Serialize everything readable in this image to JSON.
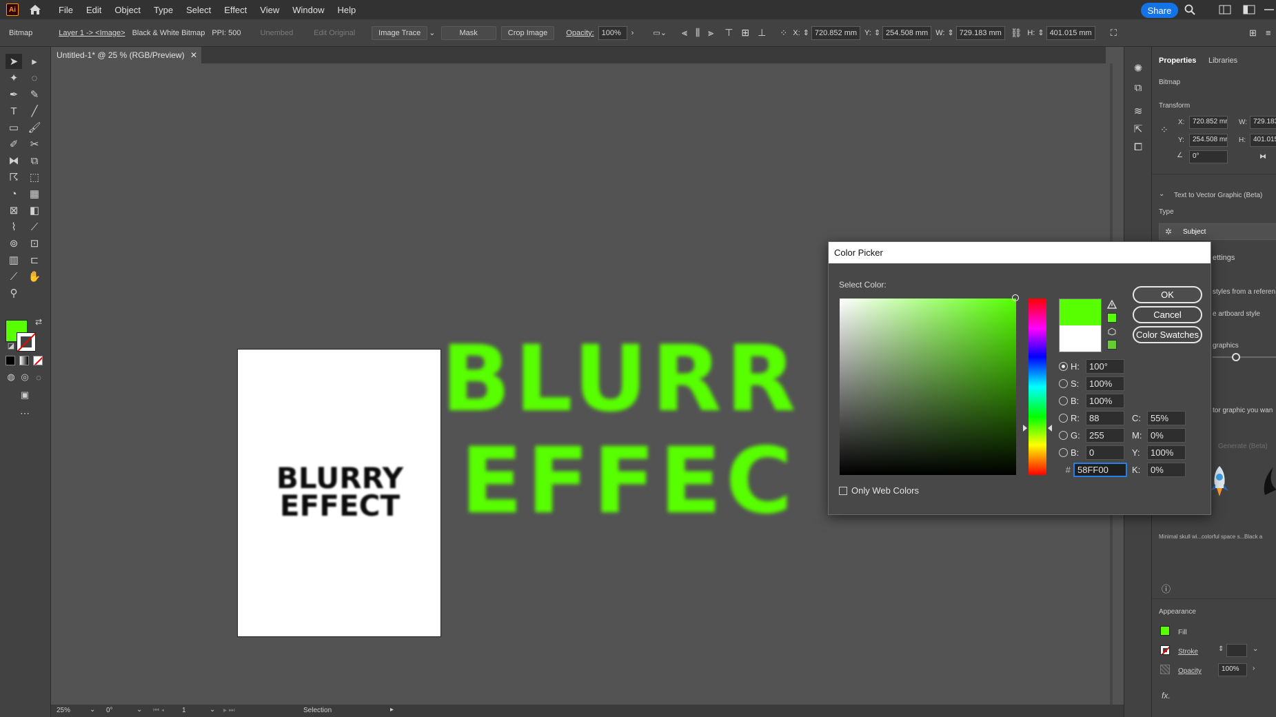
{
  "menubar": {
    "logo": "Ai",
    "items": [
      "File",
      "Edit",
      "Object",
      "Type",
      "Select",
      "Effect",
      "View",
      "Window",
      "Help"
    ],
    "share_label": "Share"
  },
  "controlbar": {
    "object_type": "Bitmap",
    "breadcrumb": "Layer 1 -> <Image>",
    "image_mode": "Black & White Bitmap",
    "ppi": "PPI: 500",
    "unembed": "Unembed",
    "edit_original": "Edit Original",
    "image_trace": "Image Trace",
    "mask": "Mask",
    "crop_image": "Crop Image",
    "opacity_label": "Opacity:",
    "opacity_value": "100%",
    "x_label": "X:",
    "x_value": "720.852 mm",
    "y_label": "Y:",
    "y_value": "254.508 mm",
    "w_label": "W:",
    "w_value": "729.183 mm",
    "h_label": "H:",
    "h_value": "401.015 mm"
  },
  "document": {
    "tab_title": "Untitled-1* @ 25 % (RGB/Preview)",
    "artboard_text": [
      "BLURRY",
      "EFFECT"
    ],
    "big_text": [
      "BLURR",
      "EFFEC"
    ],
    "fill_color": "#58FF00"
  },
  "statusbar": {
    "zoom": "25%",
    "rotation": "0°",
    "artboard": "1",
    "tool": "Selection"
  },
  "properties": {
    "tabs": [
      "Properties",
      "Libraries"
    ],
    "section_title": "Bitmap",
    "transform_label": "Transform",
    "x_label": "X:",
    "x_value": "720.852 mr",
    "w_label": "W:",
    "w_value": "729.183",
    "y_label": "Y:",
    "y_value": "254.508 mr",
    "h_label": "H:",
    "h_value": "401.015",
    "angle_value": "0°",
    "t2v_title": "Text to Vector Graphic (Beta)",
    "type_label": "Type",
    "subject_label": "Subject",
    "settings_partial": "ettings",
    "styles_partial": "styles from a referen",
    "artboard_partial": "e artboard style",
    "graphics_partial": "graphics",
    "prompt_partial": "tor graphic you wan",
    "generate_partial": "Generate (Beta)",
    "thumb_captions": [
      "Minimal skull wi...",
      "colorful space s...",
      "Black a"
    ],
    "appearance_label": "Appearance",
    "fill_label": "Fill",
    "stroke_label": "Stroke",
    "opacity_label": "Opacity",
    "opacity_value": "100%",
    "fx_label": "fx."
  },
  "color_picker": {
    "title": "Color Picker",
    "select_color_label": "Select Color:",
    "ok_label": "OK",
    "cancel_label": "Cancel",
    "swatches_label": "Color Swatches",
    "h_label": "H:",
    "h_value": "100°",
    "s_label": "S:",
    "s_value": "100%",
    "b_label": "B:",
    "b_value": "100%",
    "r_label": "R:",
    "r_value": "88",
    "g_label": "G:",
    "g_value": "255",
    "bb_label": "B:",
    "bb_value": "0",
    "c_label": "C:",
    "c_value": "55%",
    "m_label": "M:",
    "m_value": "0%",
    "yy_label": "Y:",
    "yy_value": "100%",
    "k_label": "K:",
    "k_value": "0%",
    "hash_label": "#",
    "hex_value": "58FF00",
    "web_colors_label": "Only Web Colors",
    "new_color": "#58FF00",
    "old_color": "#FFFFFF"
  }
}
